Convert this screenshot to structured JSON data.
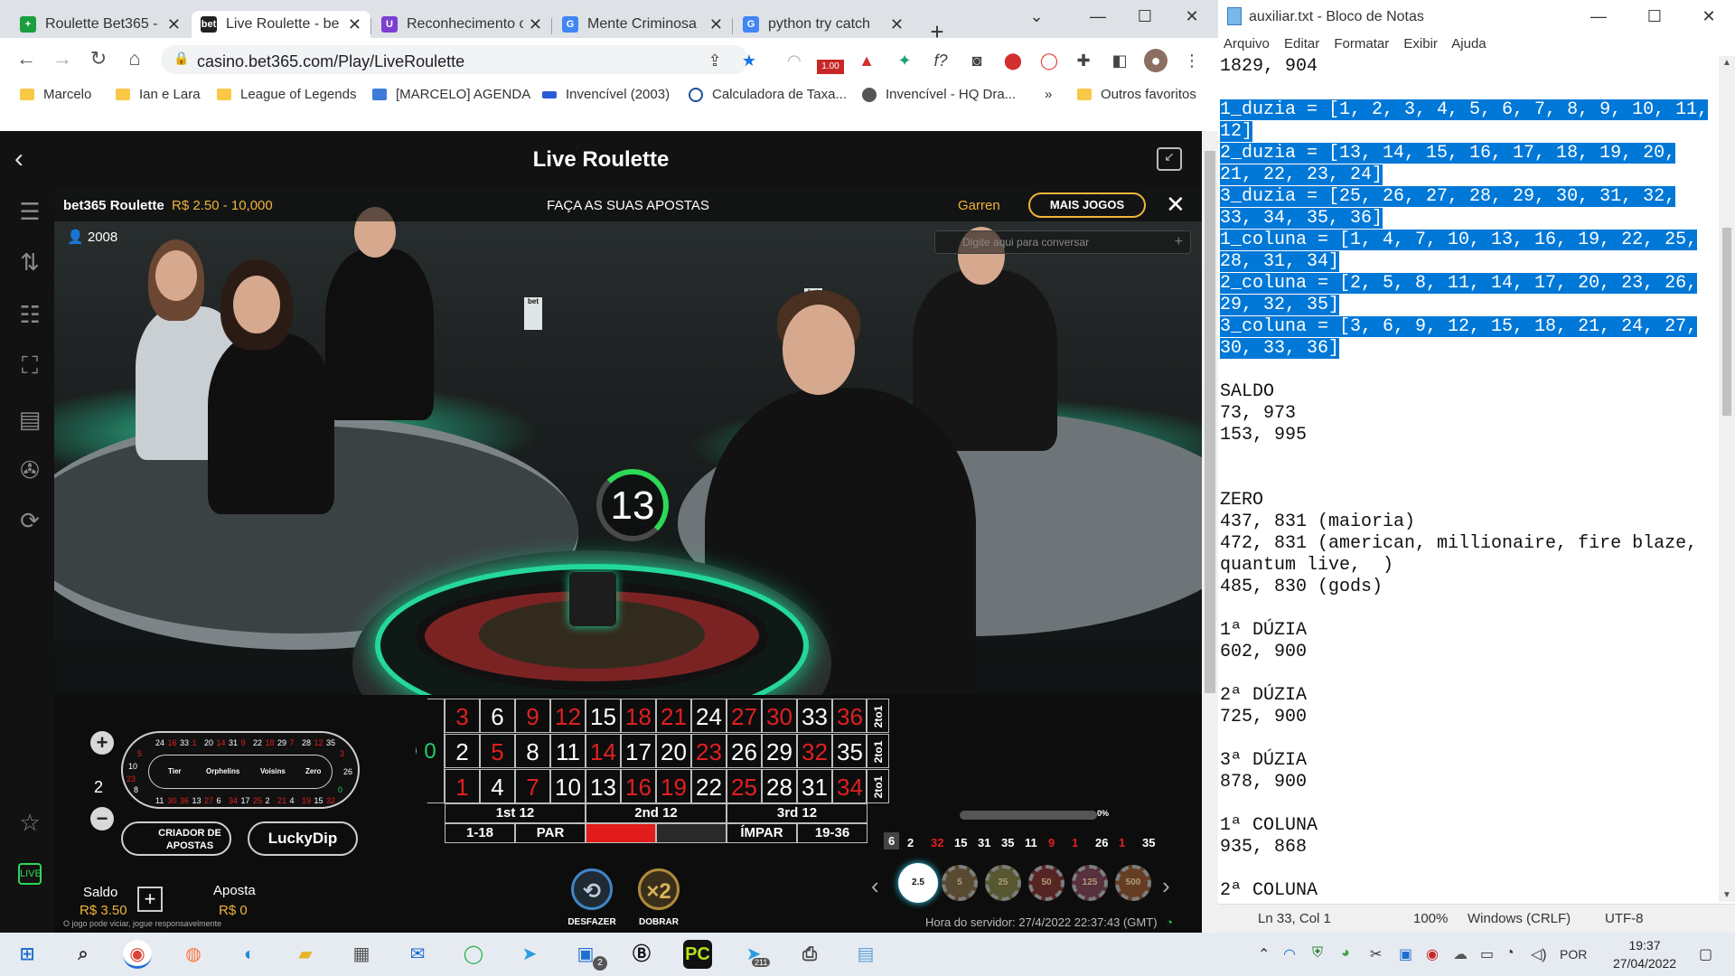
{
  "browser": {
    "tabs": [
      {
        "label": "Roulette Bet365 -",
        "icon": "plus-cross-icon",
        "color": "#1a9e3e",
        "glyph": "+"
      },
      {
        "label": "Live Roulette - be",
        "icon": "bet365-icon",
        "color": "#222222",
        "glyph": "bet"
      },
      {
        "label": "Reconhecimento c",
        "icon": "extension-icon",
        "color": "#7b3fd1",
        "glyph": "U"
      },
      {
        "label": "Mente Criminosa",
        "icon": "google-icon",
        "color": "#4285f4",
        "glyph": "G"
      },
      {
        "label": "python try catch",
        "icon": "google-icon",
        "color": "#4285f4",
        "glyph": "G"
      }
    ],
    "url": "casino.bet365.com/Play/LiveRoulette",
    "ext_badge": "1.00",
    "bookmarks": [
      "Marcelo",
      "Ian e Lara",
      "League of Legends",
      "[MARCELO] AGENDA",
      "Invencível (2003)",
      "Calculadora de Taxa...",
      "Invencível - HQ Dra...",
      "»",
      "Outros favoritos"
    ]
  },
  "site": {
    "header_title": "Live Roulette"
  },
  "game": {
    "name": "bet365 Roulette",
    "limits": "R$ 2.50 - 10,000",
    "status": "FAÇA AS SUAS APOSTAS",
    "dealer": "Garren",
    "more_games": "MAIS JOGOS",
    "players": "2008",
    "chat_placeholder": "Digite aqui para conversar",
    "timer": "13",
    "neighbours": "2",
    "race_labels": [
      "Tier",
      "Orphelins",
      "Voisins",
      "Zero"
    ],
    "race_top": [
      "24",
      "16",
      "33",
      "1",
      "20",
      "14",
      "31",
      "9",
      "22",
      "18",
      "29",
      "7",
      "28",
      "12",
      "35"
    ],
    "race_bottom": [
      "11",
      "30",
      "36",
      "13",
      "27",
      "6",
      "34",
      "17",
      "25",
      "2",
      "21",
      "4",
      "19",
      "15",
      "32"
    ],
    "race_left": [
      "5",
      "10",
      "23",
      "8"
    ],
    "race_right": [
      "3",
      "26",
      "0"
    ],
    "creator_label": "CRIADOR DE APOSTAS",
    "lucky_label": "LuckyDip",
    "saldo_label": "Saldo",
    "saldo_value": "R$ 3.50",
    "aposta_label": "Aposta",
    "aposta_value": "R$ 0",
    "zero": "0",
    "grid_rows": [
      [
        {
          "n": "3",
          "r": true
        },
        {
          "n": "6",
          "r": false
        },
        {
          "n": "9",
          "r": true
        },
        {
          "n": "12",
          "r": true
        },
        {
          "n": "15",
          "r": false
        },
        {
          "n": "18",
          "r": true
        },
        {
          "n": "21",
          "r": true
        },
        {
          "n": "24",
          "r": false
        },
        {
          "n": "27",
          "r": true
        },
        {
          "n": "30",
          "r": true
        },
        {
          "n": "33",
          "r": false
        },
        {
          "n": "36",
          "r": true
        }
      ],
      [
        {
          "n": "2",
          "r": false
        },
        {
          "n": "5",
          "r": true
        },
        {
          "n": "8",
          "r": false
        },
        {
          "n": "11",
          "r": false
        },
        {
          "n": "14",
          "r": true
        },
        {
          "n": "17",
          "r": false
        },
        {
          "n": "20",
          "r": false
        },
        {
          "n": "23",
          "r": true
        },
        {
          "n": "26",
          "r": false
        },
        {
          "n": "29",
          "r": false
        },
        {
          "n": "32",
          "r": true
        },
        {
          "n": "35",
          "r": false
        }
      ],
      [
        {
          "n": "1",
          "r": true
        },
        {
          "n": "4",
          "r": false
        },
        {
          "n": "7",
          "r": true
        },
        {
          "n": "10",
          "r": false
        },
        {
          "n": "13",
          "r": false
        },
        {
          "n": "16",
          "r": true
        },
        {
          "n": "19",
          "r": true
        },
        {
          "n": "22",
          "r": false
        },
        {
          "n": "25",
          "r": true
        },
        {
          "n": "28",
          "r": false
        },
        {
          "n": "31",
          "r": false
        },
        {
          "n": "34",
          "r": true
        }
      ]
    ],
    "col_label": "2to1",
    "dozens": [
      "1st 12",
      "2nd 12",
      "3rd 12"
    ],
    "even_bets": [
      "1-18",
      "PAR",
      "",
      "",
      "ÍMPAR",
      "19-36"
    ],
    "undo_label": "DESFAZER",
    "double_label": "DOBRAR",
    "double_glyph": "×2",
    "history": [
      {
        "n": "6",
        "r": false
      },
      {
        "n": "2",
        "r": false
      },
      {
        "n": "32",
        "r": true
      },
      {
        "n": "15",
        "r": false
      },
      {
        "n": "31",
        "r": false
      },
      {
        "n": "35",
        "r": false
      },
      {
        "n": "11",
        "r": false
      },
      {
        "n": "9",
        "r": true
      },
      {
        "n": "1",
        "r": true
      },
      {
        "n": "26",
        "r": false
      },
      {
        "n": "1",
        "r": true
      },
      {
        "n": "35",
        "r": false
      }
    ],
    "chips": [
      "2.5",
      "5",
      "25",
      "50",
      "125",
      "500"
    ],
    "progress_label": "0%",
    "progress": 0,
    "server_time": "Hora do servidor: 27/4/2022 22:37:43 (GMT)",
    "responsible": "O jogo pode viciar, jogue responsavelmente"
  },
  "notepad": {
    "title": "auxiliar.txt - Bloco de Notas",
    "menu": [
      "Arquivo",
      "Editar",
      "Formatar",
      "Exibir",
      "Ajuda"
    ],
    "lines": [
      {
        "t": "1829, 904",
        "s": false
      },
      {
        "t": "",
        "s": false
      },
      {
        "t": "1_duzia = [1, 2, 3, 4, 5, 6, 7, 8, 9, 10, 11,",
        "s": true
      },
      {
        "t": "12]",
        "s": true
      },
      {
        "t": "2_duzia = [13, 14, 15, 16, 17, 18, 19, 20,",
        "s": true
      },
      {
        "t": "21, 22, 23, 24]",
        "s": true
      },
      {
        "t": "3_duzia = [25, 26, 27, 28, 29, 30, 31, 32,",
        "s": true
      },
      {
        "t": "33, 34, 35, 36]",
        "s": true
      },
      {
        "t": "1_coluna = [1, 4, 7, 10, 13, 16, 19, 22, 25,",
        "s": true
      },
      {
        "t": "28, 31, 34]",
        "s": true
      },
      {
        "t": "2_coluna = [2, 5, 8, 11, 14, 17, 20, 23, 26,",
        "s": true
      },
      {
        "t": "29, 32, 35]",
        "s": true
      },
      {
        "t": "3_coluna = [3, 6, 9, 12, 15, 18, 21, 24, 27,",
        "s": true
      },
      {
        "t": "30, 33, 36]",
        "s": true
      },
      {
        "t": "",
        "s": false
      },
      {
        "t": "SALDO",
        "s": false
      },
      {
        "t": "73, 973",
        "s": false
      },
      {
        "t": "153, 995",
        "s": false
      },
      {
        "t": "",
        "s": false
      },
      {
        "t": "",
        "s": false
      },
      {
        "t": "ZERO",
        "s": false
      },
      {
        "t": "437, 831 (maioria)",
        "s": false
      },
      {
        "t": "472, 831 (american, millionaire, fire blaze,",
        "s": false
      },
      {
        "t": "quantum live,  )",
        "s": false
      },
      {
        "t": "485, 830 (gods)",
        "s": false
      },
      {
        "t": "",
        "s": false
      },
      {
        "t": "1ª DÚZIA",
        "s": false
      },
      {
        "t": "602, 900",
        "s": false
      },
      {
        "t": "",
        "s": false
      },
      {
        "t": "2ª DÚZIA",
        "s": false
      },
      {
        "t": "725, 900",
        "s": false
      },
      {
        "t": "",
        "s": false
      },
      {
        "t": "3ª DÚZIA",
        "s": false
      },
      {
        "t": "878, 900",
        "s": false
      },
      {
        "t": "",
        "s": false
      },
      {
        "t": "1ª COLUNA",
        "s": false
      },
      {
        "t": "935, 868",
        "s": false
      },
      {
        "t": "",
        "s": false
      },
      {
        "t": "2ª COLUNA",
        "s": false
      }
    ],
    "status": {
      "pos": "Ln 33, Col 1",
      "zoom": "100%",
      "eol": "Windows (CRLF)",
      "enc": "UTF-8"
    }
  },
  "taskbar": {
    "lang": "POR",
    "time": "19:37",
    "date": "27/04/2022",
    "badge_a": "2",
    "badge_b": "211"
  }
}
